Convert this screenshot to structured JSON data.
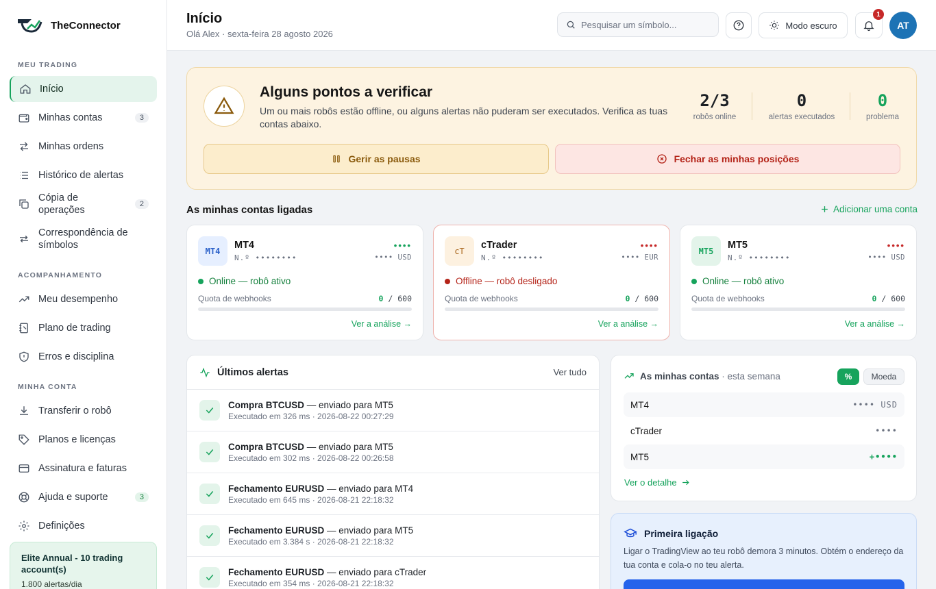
{
  "brand": {
    "name": "TheConnector"
  },
  "sidebar": {
    "sections": [
      "MEU TRADING",
      "ACOMPANHAMENTO",
      "MINHA CONTA"
    ],
    "items": [
      {
        "label": "Início",
        "icon": "home-icon"
      },
      {
        "label": "Minhas contas",
        "icon": "wallet-icon",
        "count": "3"
      },
      {
        "label": "Minhas ordens",
        "icon": "swap-icon"
      },
      {
        "label": "Histórico de alertas",
        "icon": "list-icon"
      },
      {
        "label": "Cópia de operações",
        "icon": "copy-icon",
        "count": "2"
      },
      {
        "label": "Correspondência de símbolos",
        "icon": "arrows-icon"
      },
      {
        "label": "Meu desempenho",
        "icon": "trend-icon"
      },
      {
        "label": "Plano de trading",
        "icon": "notebook-icon"
      },
      {
        "label": "Erros e disciplina",
        "icon": "shield-alert-icon"
      },
      {
        "label": "Transferir o robô",
        "icon": "download-icon"
      },
      {
        "label": "Planos e licenças",
        "icon": "tag-icon"
      },
      {
        "label": "Assinatura e faturas",
        "icon": "card-icon"
      },
      {
        "label": "Ajuda e suporte",
        "icon": "lifebuoy-icon",
        "count": "3"
      },
      {
        "label": "Definições",
        "icon": "gear-icon"
      }
    ],
    "plan": {
      "title": "Elite Annual - 10 trading account(s)",
      "sub": "1.800 alertas/dia"
    }
  },
  "header": {
    "title": "Início",
    "subtitle": "Olá Alex · sexta-feira 28 agosto 2026",
    "search_placeholder": "Pesquisar um símbolo...",
    "dark_mode": "Modo escuro",
    "notifications": "1",
    "avatar": "AT"
  },
  "warning": {
    "title": "Alguns pontos a verificar",
    "desc": "Um ou mais robôs estão offline, ou alguns alertas não puderam ser executados. Verifica as tuas contas abaixo.",
    "stats": [
      {
        "value": "2/3",
        "label": "robôs online"
      },
      {
        "value": "0",
        "label": "alertas executados"
      },
      {
        "value": "0",
        "label": "problema"
      }
    ],
    "pause_btn": "Gerir as pausas",
    "close_btn": "Fechar as minhas posições"
  },
  "accounts": {
    "title": "As minhas contas ligadas",
    "add": "Adicionar uma conta",
    "quota_label": "Quota de webhooks",
    "link": "Ver a análise →",
    "items": [
      {
        "logo": "MT4",
        "name": "MT4",
        "number": "N.º ••••••••",
        "dots": "••••",
        "currency": "•••• USD",
        "status": "Online — robô ativo",
        "quota_used": "0",
        "quota_sep": "/",
        "quota_total": "600",
        "online": true
      },
      {
        "logo": "cT",
        "name": "cTrader",
        "number": "N.º ••••••••",
        "dots": "••••",
        "currency": "•••• EUR",
        "status": "Offline — robô desligado",
        "quota_used": "0",
        "quota_sep": "/",
        "quota_total": "600",
        "online": false
      },
      {
        "logo": "MT5",
        "name": "MT5",
        "number": "N.º ••••••••",
        "dots": "••••",
        "currency": "•••• USD",
        "status": "Online — robô ativo",
        "quota_used": "0",
        "quota_sep": "/",
        "quota_total": "600",
        "online": true
      }
    ]
  },
  "alerts": {
    "title": "Últimos alertas",
    "see_all": "Ver tudo",
    "items": [
      {
        "action": "Compra BTCUSD",
        "target": " — enviado para MT5",
        "detail": "Executado em 326 ms · 2026-08-22 00:27:29"
      },
      {
        "action": "Compra BTCUSD",
        "target": " — enviado para MT5",
        "detail": "Executado em 302 ms · 2026-08-22 00:26:58"
      },
      {
        "action": "Fechamento EURUSD",
        "target": " — enviado para MT4",
        "detail": "Executado em 645 ms · 2026-08-21 22:18:32"
      },
      {
        "action": "Fechamento EURUSD",
        "target": " — enviado para MT5",
        "detail": "Executado em 3.384 s · 2026-08-21 22:18:32"
      },
      {
        "action": "Fechamento EURUSD",
        "target": " — enviado para cTrader",
        "detail": "Executado em 354 ms · 2026-08-21 22:18:32"
      }
    ]
  },
  "weekly": {
    "title": "As minhas contas",
    "title_suffix": " · esta semana",
    "pct": "%",
    "currency": "Moeda",
    "rows": [
      {
        "name": "MT4",
        "value": "•••• USD"
      },
      {
        "name": "cTrader",
        "value": "••••"
      },
      {
        "name": "MT5",
        "value": "+••••"
      }
    ],
    "link": "Ver o detalhe"
  },
  "first": {
    "title": "Primeira ligação",
    "desc": "Ligar o TradingView ao teu robô demora 3 minutos. Obtém o endereço da tua conta e cola-o no teu alerta."
  },
  "colors": {
    "accent": "#16a35c",
    "warning_bg": "#fdf3e1",
    "danger": "#b42318",
    "info_bg": "#e7f0fd"
  }
}
